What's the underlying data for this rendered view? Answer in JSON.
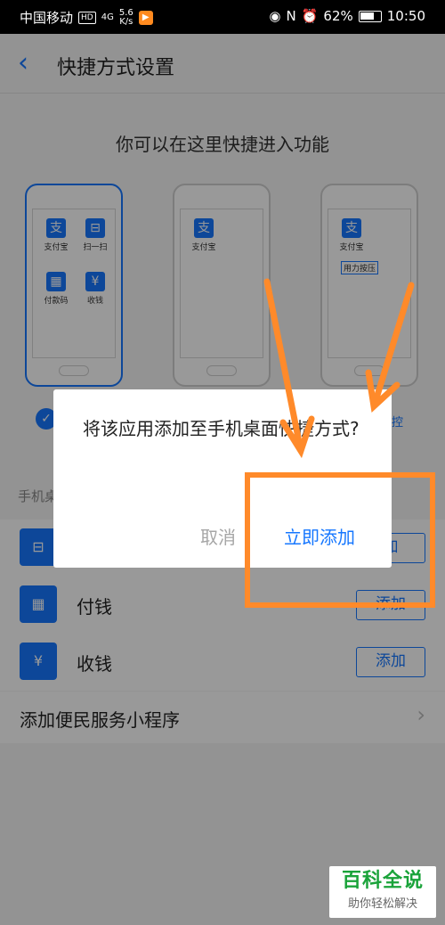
{
  "status": {
    "carrier": "中国移动",
    "hd": "HD",
    "signal": "4G",
    "speed_value": "5.6",
    "speed_unit": "K/s",
    "battery": "62%",
    "time": "10:50",
    "nfc": "N"
  },
  "nav": {
    "back_icon": "‹",
    "title": "快捷方式设置"
  },
  "intro": "你可以在这里快捷进入功能",
  "previews": [
    {
      "items": [
        "支付宝",
        "扫一扫",
        "付款码",
        "收钱"
      ]
    },
    {
      "items": [
        "支付宝"
      ]
    },
    {
      "items": [
        "支付宝"
      ],
      "press_label": "用力按压"
    }
  ],
  "option_fragment": "控",
  "section": {
    "label_fragment": "手机桌"
  },
  "shortcuts": [
    {
      "name": "",
      "button": "加"
    },
    {
      "name": "付钱",
      "button": "添加"
    },
    {
      "name": "收钱",
      "button": "添加"
    }
  ],
  "mini_program": {
    "label": "添加便民服务小程序",
    "chevron": "›"
  },
  "dialog": {
    "message": "将该应用添加至手机桌面快捷方式?",
    "cancel": "取消",
    "confirm": "立即添加"
  },
  "annotation": {
    "color": "#ff8a2a"
  },
  "watermark": {
    "title": "百科全说",
    "subtitle": "助你轻松解决"
  },
  "colors": {
    "accent": "#1677ff",
    "annotation": "#ff8a2a",
    "watermark": "#1aa33a"
  }
}
